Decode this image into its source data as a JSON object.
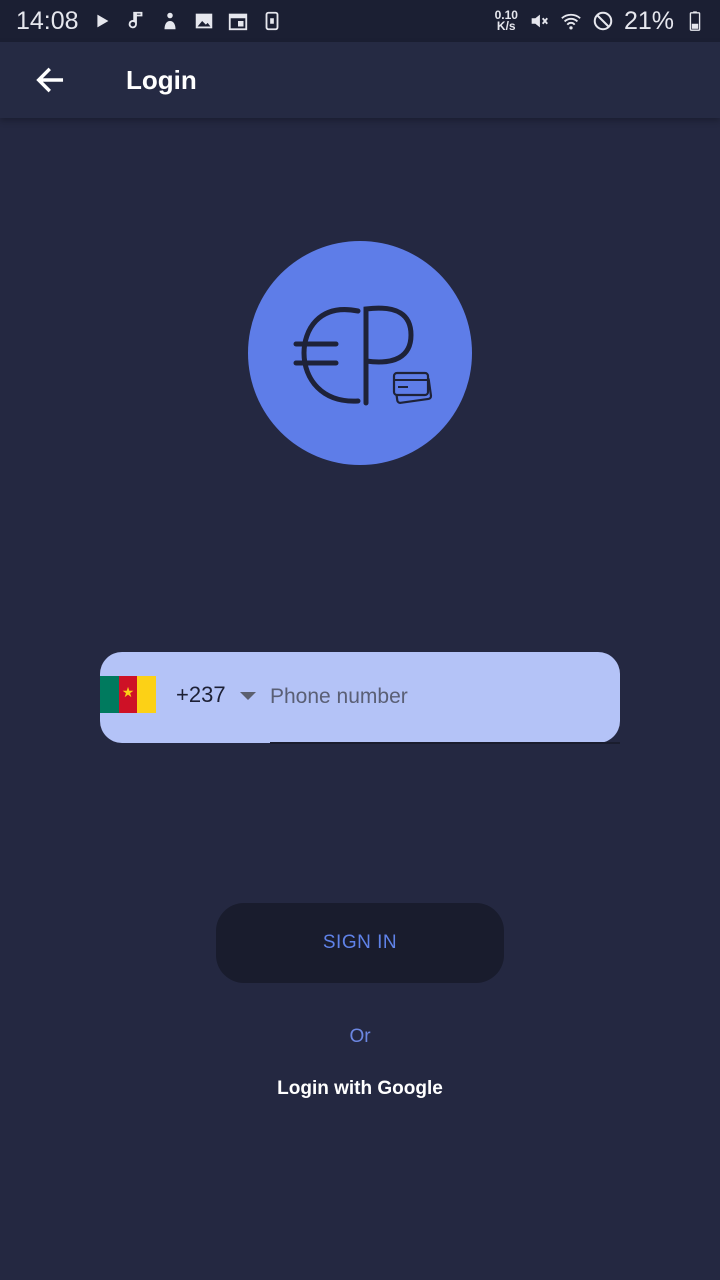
{
  "status_bar": {
    "time": "14:08",
    "net_speed_top": "0.10",
    "net_speed_bottom": "K/s",
    "battery_percent": "21%",
    "icons_left": [
      "play-icon",
      "music-note-icon",
      "person-icon",
      "image-icon",
      "calendar-icon",
      "sim-icon"
    ],
    "icons_right": [
      "mute-icon",
      "wifi-icon",
      "do-not-disturb-icon",
      "battery-icon"
    ]
  },
  "app_bar": {
    "title": "Login",
    "back_icon": "arrow-left-icon"
  },
  "logo": {
    "text": "EP",
    "icon": "credit-card-icon",
    "color": "#5e7de8"
  },
  "phone_field": {
    "country_code": "+237",
    "flag": "cameroon-flag",
    "placeholder": "Phone number",
    "value": ""
  },
  "actions": {
    "signin_label": "SIGN IN",
    "or_label": "Or",
    "google_label": "Login with Google"
  },
  "colors": {
    "background": "#242841",
    "accent": "#5e7de8",
    "field_bg": "#b4c3f7",
    "button_bg": "#191c2d"
  }
}
